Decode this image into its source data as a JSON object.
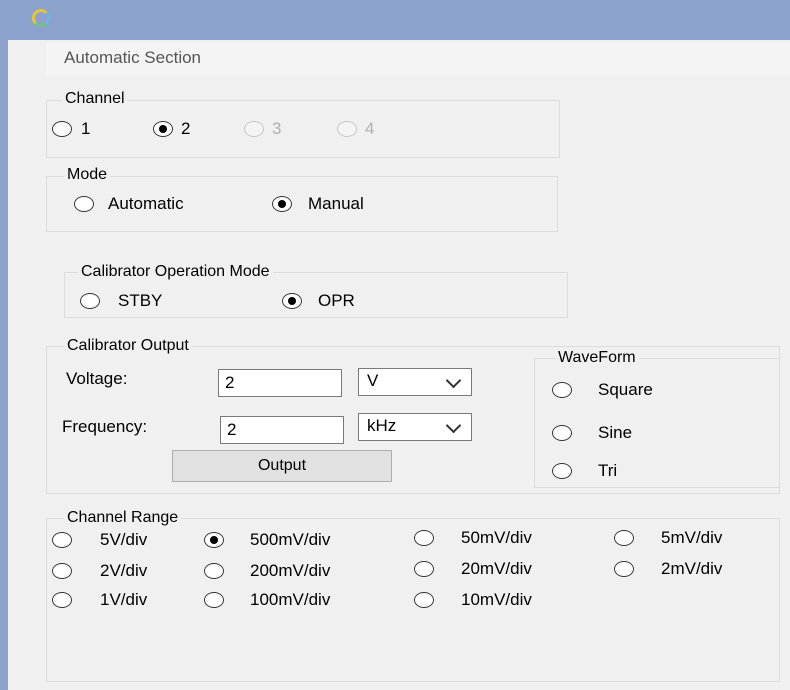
{
  "tab": {
    "label": "Automatic Section"
  },
  "channel": {
    "legend": "Channel",
    "options": [
      {
        "label": "1",
        "checked": false,
        "enabled": true
      },
      {
        "label": "2",
        "checked": true,
        "enabled": true
      },
      {
        "label": "3",
        "checked": false,
        "enabled": false
      },
      {
        "label": "4",
        "checked": false,
        "enabled": false
      }
    ]
  },
  "mode": {
    "legend": "Mode",
    "options": [
      {
        "label": "Automatic",
        "checked": false
      },
      {
        "label": "Manual",
        "checked": true
      }
    ]
  },
  "calibrator_mode": {
    "legend": "Calibrator Operation Mode",
    "options": [
      {
        "label": "STBY",
        "checked": false
      },
      {
        "label": "OPR",
        "checked": true
      }
    ]
  },
  "calibrator_output": {
    "legend": "Calibrator Output",
    "voltage_label": "Voltage:",
    "voltage_value": "2",
    "voltage_unit": "V",
    "frequency_label": "Frequency:",
    "frequency_value": "2",
    "frequency_unit": "kHz",
    "output_button": "Output"
  },
  "waveform": {
    "legend": "WaveForm",
    "options": [
      {
        "label": "Square",
        "checked": false
      },
      {
        "label": "Sine",
        "checked": false
      },
      {
        "label": "Tri",
        "checked": false
      }
    ]
  },
  "channel_range": {
    "legend": "Channel Range",
    "options": [
      {
        "label": "5V/div",
        "checked": false
      },
      {
        "label": "500mV/div",
        "checked": true
      },
      {
        "label": "50mV/div",
        "checked": false
      },
      {
        "label": "5mV/div",
        "checked": false
      },
      {
        "label": "2V/div",
        "checked": false
      },
      {
        "label": "200mV/div",
        "checked": false
      },
      {
        "label": "20mV/div",
        "checked": false
      },
      {
        "label": "2mV/div",
        "checked": false
      },
      {
        "label": "1V/div",
        "checked": false
      },
      {
        "label": "100mV/div",
        "checked": false
      },
      {
        "label": "10mV/div",
        "checked": false
      }
    ]
  },
  "colors": {
    "titlebar": "#8aa2cc",
    "panel": "#f0f0f0",
    "group_border": "#dcdcdc"
  }
}
